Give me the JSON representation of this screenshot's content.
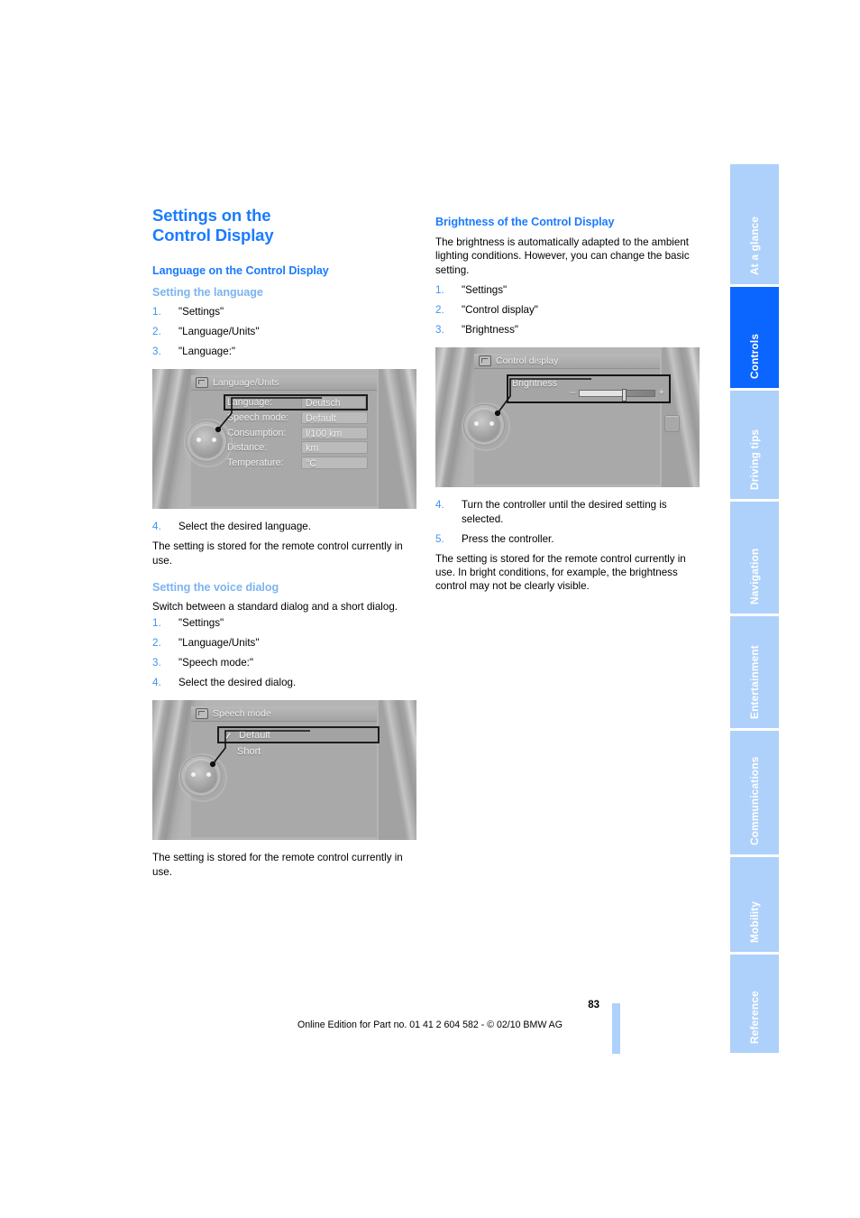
{
  "document": {
    "page_number": "83",
    "footer_note": "Online Edition for Part no. 01 41 2 604 582 - © 02/10 BMW AG",
    "accent_color": "#1a7bff",
    "tab_active_color": "#0a66ff",
    "tab_inactive_color": "#aed1fb"
  },
  "left_column": {
    "chapter_title": "Settings on the\nControl Display",
    "chapter_title_line1": "Settings on the",
    "chapter_title_line2": "Control Display",
    "section_title": "Language on the Control Display",
    "sub1": {
      "title": "Setting the language",
      "steps": [
        {
          "num": "1.",
          "text": "\"Settings\""
        },
        {
          "num": "2.",
          "text": "\"Language/Units\""
        },
        {
          "num": "3.",
          "text": "\"Language:\""
        }
      ],
      "figure": {
        "header_title": "Language/Units",
        "header_icon": "idrive-menu-icon",
        "rows": [
          {
            "label": "Language:",
            "value": "Deutsch",
            "selected": true
          },
          {
            "label": "Speech mode:",
            "value": "Default",
            "selected": false
          },
          {
            "label": "Consumption:",
            "value": "l/100 km",
            "selected": false
          },
          {
            "label": "Distance:",
            "value": "km",
            "selected": false
          },
          {
            "label": "Temperature:",
            "value": "°C",
            "selected": false
          }
        ]
      },
      "post_steps": [
        {
          "num": "4.",
          "text": "Select the desired language."
        }
      ],
      "note": "The setting is stored for the remote control currently in use."
    },
    "sub2": {
      "title": "Setting the voice dialog",
      "intro": "Switch between a standard dialog and a short dialog.",
      "steps": [
        {
          "num": "1.",
          "text": "\"Settings\""
        },
        {
          "num": "2.",
          "text": "\"Language/Units\""
        },
        {
          "num": "3.",
          "text": "\"Speech mode:\""
        },
        {
          "num": "4.",
          "text": "Select the desired dialog."
        }
      ],
      "figure": {
        "header_title": "Speech mode",
        "header_icon": "idrive-menu-icon",
        "rows": [
          {
            "label": "Default",
            "selected": true,
            "checkmark": "✓"
          },
          {
            "label": "Short",
            "selected": false,
            "checkmark": ""
          }
        ]
      },
      "note": "The setting is stored for the remote control currently in use."
    }
  },
  "right_column": {
    "section_title": "Brightness of the Control Display",
    "intro": "The brightness is automatically adapted to the ambient lighting conditions. However, you can change the basic setting.",
    "steps": [
      {
        "num": "1.",
        "text": "\"Settings\""
      },
      {
        "num": "2.",
        "text": "\"Control display\""
      },
      {
        "num": "3.",
        "text": "\"Brightness\""
      }
    ],
    "figure": {
      "header_title": "Control display",
      "header_icon": "idrive-menu-icon",
      "brightness_label": "Brightness",
      "slider_minus": "–",
      "slider_plus": "+",
      "slider_value_percent": 58
    },
    "post_steps": [
      {
        "num": "4.",
        "text": "Turn the controller until the desired setting is selected."
      },
      {
        "num": "5.",
        "text": "Press the controller."
      }
    ],
    "note": "The setting is stored for the remote control currently in use. In bright conditions, for example, the brightness control may not be clearly visible."
  },
  "tab_rail": {
    "items": [
      {
        "label": "At a glance",
        "active": false
      },
      {
        "label": "Controls",
        "active": true
      },
      {
        "label": "Driving tips",
        "active": false
      },
      {
        "label": "Navigation",
        "active": false
      },
      {
        "label": "Entertainment",
        "active": false
      },
      {
        "label": "Communications",
        "active": false
      },
      {
        "label": "Mobility",
        "active": false
      },
      {
        "label": "Reference",
        "active": false
      }
    ]
  }
}
